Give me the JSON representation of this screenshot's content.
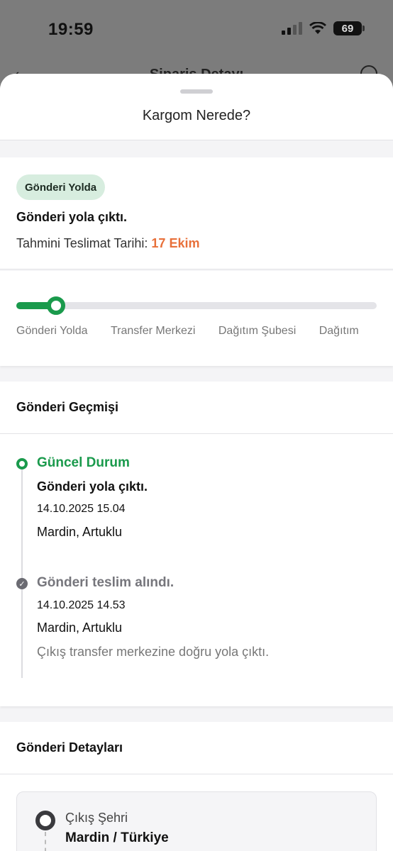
{
  "status_bar": {
    "time": "19:59",
    "battery": "69"
  },
  "behind": {
    "title": "Sipariş Detayı"
  },
  "sheet": {
    "title": "Kargom Nerede?"
  },
  "status": {
    "badge": "Gönderi Yolda",
    "message": "Gönderi yola çıktı.",
    "eta_label": "Tahmini Teslimat Tarihi:",
    "eta_date": "17 Ekim"
  },
  "progress": {
    "fraction": 0.11,
    "steps": [
      "Gönderi Yolda",
      "Transfer Merkezi",
      "Dağıtım Şubesi",
      "Dağıtım"
    ]
  },
  "history": {
    "title": "Gönderi Geçmişi",
    "events": [
      {
        "title": "Güncel Durum",
        "status": "Gönderi yola çıktı.",
        "datetime": "14.10.2025 15.04",
        "location": "Mardin, Artuklu",
        "note": ""
      },
      {
        "title": "Gönderi teslim alındı.",
        "status": "",
        "datetime": "14.10.2025 14.53",
        "location": "Mardin, Artuklu",
        "note": "Çıkış transfer merkezine doğru yola çıktı."
      }
    ]
  },
  "details": {
    "title": "Gönderi Detayları",
    "origin_label": "Çıkış Şehri",
    "origin_value": "Mardin / Türkiye"
  }
}
